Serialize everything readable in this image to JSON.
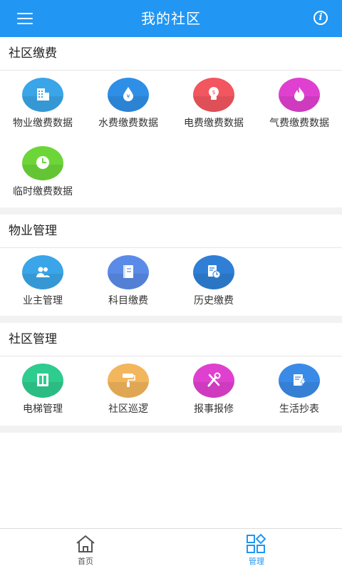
{
  "header": {
    "title": "我的社区",
    "menu_icon": "menu-icon",
    "info_icon": "info-icon"
  },
  "sections": [
    {
      "title": "社区缴费",
      "items": [
        {
          "label": "物业缴费数据",
          "icon": "building-icon",
          "color": "#3AA5E8"
        },
        {
          "label": "水费缴费数据",
          "icon": "water-drop-icon",
          "color": "#2F8FE6"
        },
        {
          "label": "电费缴费数据",
          "icon": "lightbulb-icon",
          "color": "#F2565F"
        },
        {
          "label": "气费缴费数据",
          "icon": "flame-icon",
          "color": "#E040CF"
        },
        {
          "label": "临时缴费数据",
          "icon": "clock-icon",
          "color": "#6CD638"
        }
      ]
    },
    {
      "title": "物业管理",
      "items": [
        {
          "label": "业主管理",
          "icon": "users-icon",
          "color": "#3AA5E8"
        },
        {
          "label": "科目缴费",
          "icon": "notebook-icon",
          "color": "#5B8BE8"
        },
        {
          "label": "历史缴费",
          "icon": "history-icon",
          "color": "#2F7FD6"
        }
      ]
    },
    {
      "title": "社区管理",
      "items": [
        {
          "label": "电梯管理",
          "icon": "elevator-icon",
          "color": "#2ECC8E"
        },
        {
          "label": "社区巡逻",
          "icon": "paint-roller-icon",
          "color": "#F2B65C"
        },
        {
          "label": "报事报修",
          "icon": "tools-icon",
          "color": "#E040CF"
        },
        {
          "label": "生活抄表",
          "icon": "meter-note-icon",
          "color": "#3A8AE8"
        }
      ]
    }
  ],
  "bottom_nav": [
    {
      "label": "首页",
      "icon": "home-icon",
      "active": false,
      "color": "#555555"
    },
    {
      "label": "管理",
      "icon": "grid-icon",
      "active": true,
      "color": "#2196F3"
    }
  ]
}
